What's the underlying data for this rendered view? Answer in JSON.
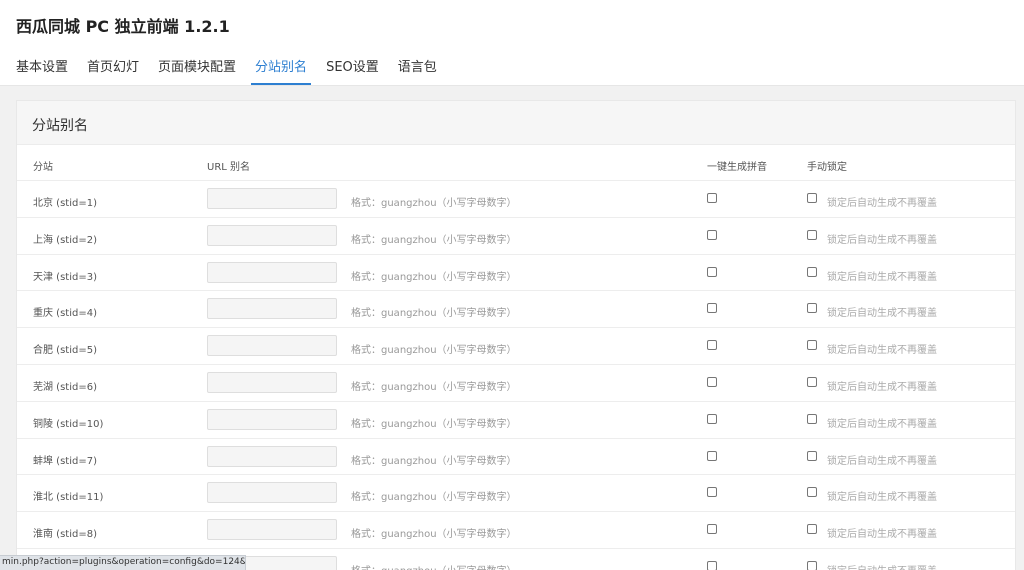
{
  "app": {
    "title": "西瓜同城 PC 独立前端 1.2.1"
  },
  "tabs": [
    {
      "label": "基本设置",
      "active": false
    },
    {
      "label": "首页幻灯",
      "active": false
    },
    {
      "label": "页面模块配置",
      "active": false
    },
    {
      "label": "分站别名",
      "active": true
    },
    {
      "label": "SEO设置",
      "active": false
    },
    {
      "label": "语言包",
      "active": false
    }
  ],
  "panel": {
    "title": "分站别名",
    "columns": {
      "site": "分站",
      "alias": "URL 别名",
      "pinyin": "一键生成拼音",
      "lock": "手动锁定"
    },
    "input_hint": "格式：guangzhou（小写字母数字）",
    "lock_hint": "锁定后自动生成不再覆盖",
    "rows": [
      {
        "name": "北京 (stid=1)",
        "alias": "",
        "pinyin_checked": false,
        "lock_checked": false
      },
      {
        "name": "上海 (stid=2)",
        "alias": "",
        "pinyin_checked": false,
        "lock_checked": false
      },
      {
        "name": "天津 (stid=3)",
        "alias": "",
        "pinyin_checked": false,
        "lock_checked": false
      },
      {
        "name": "重庆 (stid=4)",
        "alias": "",
        "pinyin_checked": false,
        "lock_checked": false
      },
      {
        "name": "合肥 (stid=5)",
        "alias": "",
        "pinyin_checked": false,
        "lock_checked": false
      },
      {
        "name": "芜湖 (stid=6)",
        "alias": "",
        "pinyin_checked": false,
        "lock_checked": false
      },
      {
        "name": "铜陵 (stid=10)",
        "alias": "",
        "pinyin_checked": false,
        "lock_checked": false
      },
      {
        "name": "蚌埠 (stid=7)",
        "alias": "",
        "pinyin_checked": false,
        "lock_checked": false
      },
      {
        "name": "淮北 (stid=11)",
        "alias": "",
        "pinyin_checked": false,
        "lock_checked": false
      },
      {
        "name": "淮南 (stid=8)",
        "alias": "",
        "pinyin_checked": false,
        "lock_checked": false
      },
      {
        "name": "",
        "alias": "",
        "pinyin_checked": false,
        "lock_checked": false
      }
    ]
  },
  "status_bar": {
    "url": "min.php?action=plugins&operation=config&do=124&ide..."
  },
  "colors": {
    "accent": "#2d7fd1",
    "background": "#f1f1f1",
    "hint": "#999999"
  }
}
